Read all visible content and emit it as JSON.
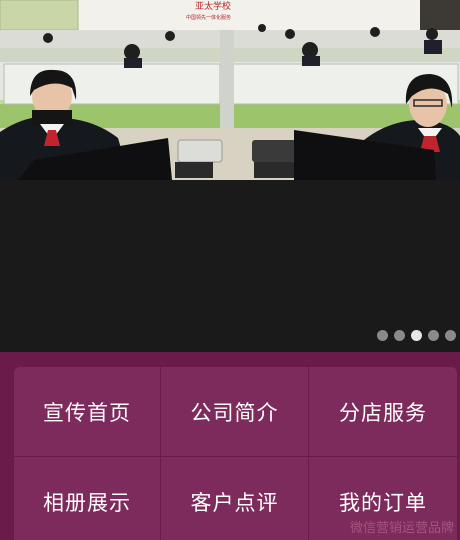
{
  "banner": {
    "slides_total": 5,
    "active_slide": 3,
    "photo_sign": "亚太学校",
    "photo_sign_small": "中国领先一体化服务"
  },
  "menu": {
    "items": [
      {
        "label": "宣传首页",
        "icon": "none"
      },
      {
        "label": "公司简介",
        "icon": "none"
      },
      {
        "label": "分店服务",
        "icon": "none"
      },
      {
        "label": "相册展示",
        "icon": "none"
      },
      {
        "label": "客户点评",
        "icon": "none"
      },
      {
        "label": "我的订单",
        "icon": "none"
      }
    ]
  },
  "watermark": "微信营销运营品牌",
  "colors": {
    "menu_bg": "#6a1b4a",
    "cell_bg": "#7d2a5c",
    "banner_bg": "#1a1a1a",
    "dot_active": "#e6e6e6",
    "dot_inactive": "#8a8a8a"
  }
}
